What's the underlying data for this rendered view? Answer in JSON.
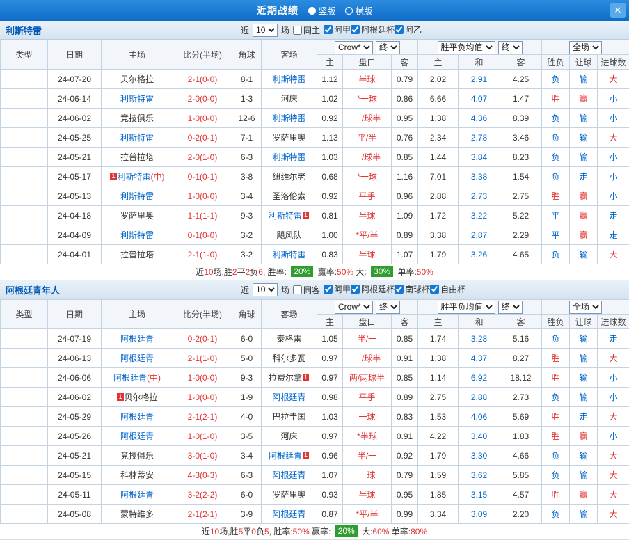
{
  "topbar": {
    "title": "近期战绩",
    "vertical": "竖版",
    "horizontal": "横版",
    "close_glyph": "✕"
  },
  "labels": {
    "near": "近",
    "count": "10",
    "games": "场"
  },
  "badge_char": "1",
  "th": {
    "type": "类型",
    "date": "日期",
    "host": "主场",
    "score": "比分(半场)",
    "corner": "角球",
    "guest": "客场",
    "company": "Crow*",
    "final": "终",
    "avg": "胜平负均值",
    "scope": "全场",
    "home": "主",
    "handicap": "盘口",
    "away": "客",
    "avg_home": "主",
    "avg_draw": "和",
    "avg_away": "客",
    "result": "胜负",
    "let": "让球",
    "goals": "进球数"
  },
  "colors": {
    "topbar_blue": "#1177d4",
    "accent_blue": "#0066cc",
    "score_red": "#e23333",
    "league_jia_blue": "#4190e2",
    "league_cup_purple": "#6673c4",
    "league_nan_gold": "#d09b35",
    "badge_green": "#2f9e2f"
  },
  "sections": [
    {
      "title": "利斯特雷",
      "same_label": "同主",
      "filters": [
        {
          "label": "阿甲",
          "checked": true
        },
        {
          "label": "阿根廷杯",
          "checked": true
        },
        {
          "label": "阿乙",
          "checked": true
        }
      ],
      "rows": [
        {
          "lg": "阿甲",
          "lgc": "jia",
          "d": "24-07-20",
          "h": {
            "n": "贝尔格拉"
          },
          "sc": "2-1(0-0)",
          "cn": "8-1",
          "a": {
            "n": "利斯特雷",
            "sel": 1
          },
          "o1": "1.12",
          "hp": "半球",
          "o2": "0.79",
          "m1": "2.02",
          "m2": "2.91",
          "m3": "4.25",
          "r1": "负",
          "c1": "b",
          "r2": "输",
          "c2": "b",
          "r3": "大",
          "c3": "r"
        },
        {
          "lg": "阿甲",
          "lgc": "jia",
          "d": "24-06-14",
          "h": {
            "n": "利斯特雷",
            "sel": 1
          },
          "sc": "2-0(0-0)",
          "cn": "1-3",
          "a": {
            "n": "河床"
          },
          "o1": "1.02",
          "hp": "*一球",
          "o2": "0.86",
          "m1": "6.66",
          "m2": "4.07",
          "m3": "1.47",
          "r1": "胜",
          "c1": "r",
          "r2": "赢",
          "c2": "r",
          "r3": "小",
          "c3": "b"
        },
        {
          "lg": "阿甲",
          "lgc": "jia",
          "d": "24-06-02",
          "h": {
            "n": "竞技俱乐"
          },
          "sc": "1-0(0-0)",
          "cn": "12-6",
          "a": {
            "n": "利斯特雷",
            "sel": 1
          },
          "o1": "0.92",
          "hp": "一/球半",
          "o2": "0.95",
          "m1": "1.38",
          "m2": "4.36",
          "m3": "8.39",
          "r1": "负",
          "c1": "b",
          "r2": "输",
          "c2": "b",
          "r3": "小",
          "c3": "b"
        },
        {
          "lg": "阿甲",
          "lgc": "jia",
          "d": "24-05-25",
          "h": {
            "n": "利斯特雷",
            "sel": 1
          },
          "sc": "0-2(0-1)",
          "cn": "7-1",
          "a": {
            "n": "罗萨里奥"
          },
          "o1": "1.13",
          "hp": "平/半",
          "o2": "0.76",
          "m1": "2.34",
          "m2": "2.78",
          "m3": "3.46",
          "r1": "负",
          "c1": "b",
          "r2": "输",
          "c2": "b",
          "r3": "大",
          "c3": "r"
        },
        {
          "lg": "阿甲",
          "lgc": "jia",
          "d": "24-05-21",
          "h": {
            "n": "拉普拉塔"
          },
          "sc": "2-0(1-0)",
          "cn": "6-3",
          "a": {
            "n": "利斯特雷",
            "sel": 1
          },
          "o1": "1.03",
          "hp": "一/球半",
          "o2": "0.85",
          "m1": "1.44",
          "m2": "3.84",
          "m3": "8.23",
          "r1": "负",
          "c1": "b",
          "r2": "输",
          "c2": "b",
          "r3": "小",
          "c3": "b"
        },
        {
          "lg": "阿根廷杯",
          "lgc": "cup",
          "d": "24-05-17",
          "h": {
            "n": "利斯特雷",
            "sel": 1,
            "bd": "b",
            "mk": "(中)"
          },
          "sc": "0-1(0-1)",
          "cn": "3-8",
          "a": {
            "n": "纽维尔老"
          },
          "o1": "0.68",
          "hp": "*一球",
          "o2": "1.16",
          "m1": "7.01",
          "m2": "3.38",
          "m3": "1.54",
          "r1": "负",
          "c1": "b",
          "r2": "走",
          "c2": "b",
          "r3": "小",
          "c3": "b"
        },
        {
          "lg": "阿甲",
          "lgc": "jia",
          "d": "24-05-13",
          "h": {
            "n": "利斯特雷",
            "sel": 1
          },
          "sc": "1-0(0-0)",
          "cn": "3-4",
          "a": {
            "n": "圣洛伦索"
          },
          "o1": "0.92",
          "hp": "平手",
          "o2": "0.96",
          "m1": "2.88",
          "m2": "2.73",
          "m3": "2.75",
          "r1": "胜",
          "c1": "r",
          "r2": "赢",
          "c2": "r",
          "r3": "小",
          "c3": "b"
        },
        {
          "lg": "阿甲",
          "lgc": "jia",
          "d": "24-04-18",
          "h": {
            "n": "罗萨里奥"
          },
          "sc": "1-1(1-1)",
          "cn": "9-3",
          "a": {
            "n": "利斯特雷",
            "sel": 1,
            "bd": "a"
          },
          "o1": "0.81",
          "hp": "半球",
          "o2": "1.09",
          "m1": "1.72",
          "m2": "3.22",
          "m3": "5.22",
          "r1": "平",
          "c1": "b",
          "r2": "赢",
          "c2": "r",
          "r3": "走",
          "c3": "b"
        },
        {
          "lg": "阿甲",
          "lgc": "jia",
          "d": "24-04-09",
          "h": {
            "n": "利斯特雷",
            "sel": 1
          },
          "sc": "0-1(0-0)",
          "cn": "3-2",
          "a": {
            "n": "飓风队"
          },
          "o1": "1.00",
          "hp": "*平/半",
          "o2": "0.89",
          "m1": "3.38",
          "m2": "2.87",
          "m3": "2.29",
          "r1": "平",
          "c1": "b",
          "r2": "赢",
          "c2": "r",
          "r3": "走",
          "c3": "b"
        },
        {
          "lg": "阿甲",
          "lgc": "jia",
          "d": "24-04-01",
          "h": {
            "n": "拉普拉塔"
          },
          "sc": "2-1(1-0)",
          "cn": "3-2",
          "a": {
            "n": "利斯特雷",
            "sel": 1
          },
          "o1": "0.83",
          "hp": "半球",
          "o2": "1.07",
          "m1": "1.79",
          "m2": "3.26",
          "m3": "4.65",
          "r1": "负",
          "c1": "b",
          "r2": "输",
          "c2": "b",
          "r3": "大",
          "c3": "r"
        }
      ],
      "footer": [
        {
          "t": "近"
        },
        {
          "t": "10",
          "c": "red"
        },
        {
          "t": "场,胜"
        },
        {
          "t": "2",
          "c": "red"
        },
        {
          "t": "平"
        },
        {
          "t": "2",
          "c": "red"
        },
        {
          "t": "负"
        },
        {
          "t": "6",
          "c": "red"
        },
        {
          "t": ", 胜率: "
        },
        {
          "t": "20%",
          "c": "badge"
        },
        {
          "t": " 赢率:"
        },
        {
          "t": "50%",
          "c": "red"
        },
        {
          "t": " 大: "
        },
        {
          "t": "30%",
          "c": "badge"
        },
        {
          "t": " 单率:"
        },
        {
          "t": "50%",
          "c": "red"
        }
      ]
    },
    {
      "title": "阿根廷青年人",
      "same_label": "同客",
      "filters": [
        {
          "label": "阿甲",
          "checked": true
        },
        {
          "label": "阿根廷杯",
          "checked": true
        },
        {
          "label": "南球杯",
          "checked": true
        },
        {
          "label": "自由杯",
          "checked": true
        }
      ],
      "rows": [
        {
          "lg": "阿甲",
          "lgc": "jia",
          "d": "24-07-19",
          "h": {
            "n": "阿根廷青",
            "sel": 1
          },
          "sc": "0-2(0-1)",
          "cn": "6-0",
          "a": {
            "n": "泰格雷"
          },
          "o1": "1.05",
          "hp": "半/一",
          "o2": "0.85",
          "m1": "1.74",
          "m2": "3.28",
          "m3": "5.16",
          "r1": "负",
          "c1": "b",
          "r2": "输",
          "c2": "b",
          "r3": "走",
          "c3": "b"
        },
        {
          "lg": "阿甲",
          "lgc": "jia",
          "d": "24-06-13",
          "h": {
            "n": "阿根廷青",
            "sel": 1
          },
          "sc": "2-1(1-0)",
          "cn": "5-0",
          "a": {
            "n": "科尔多瓦"
          },
          "o1": "0.97",
          "hp": "一/球半",
          "o2": "0.91",
          "m1": "1.38",
          "m2": "4.37",
          "m3": "8.27",
          "r1": "胜",
          "c1": "r",
          "r2": "输",
          "c2": "b",
          "r3": "大",
          "c3": "r"
        },
        {
          "lg": "阿根廷杯",
          "lgc": "cup",
          "d": "24-06-06",
          "h": {
            "n": "阿根廷青",
            "sel": 1,
            "mk": "(中)"
          },
          "sc": "1-0(0-0)",
          "cn": "9-3",
          "a": {
            "n": "拉费尔拿",
            "bd": "a"
          },
          "o1": "0.97",
          "hp": "两/两球半",
          "o2": "0.85",
          "m1": "1.14",
          "m2": "6.92",
          "m3": "18.12",
          "r1": "胜",
          "c1": "r",
          "r2": "输",
          "c2": "b",
          "r3": "小",
          "c3": "b"
        },
        {
          "lg": "阿甲",
          "lgc": "jia",
          "d": "24-06-02",
          "h": {
            "n": "贝尔格拉",
            "bd": "b"
          },
          "sc": "1-0(0-0)",
          "cn": "1-9",
          "a": {
            "n": "阿根廷青",
            "sel": 1
          },
          "o1": "0.98",
          "hp": "平手",
          "o2": "0.89",
          "m1": "2.75",
          "m2": "2.88",
          "m3": "2.73",
          "r1": "负",
          "c1": "b",
          "r2": "输",
          "c2": "b",
          "r3": "小",
          "c3": "b"
        },
        {
          "lg": "南球杯",
          "lgc": "nan",
          "d": "24-05-29",
          "h": {
            "n": "阿根廷青",
            "sel": 1
          },
          "sc": "2-1(2-1)",
          "cn": "4-0",
          "a": {
            "n": "巴拉圭国"
          },
          "o1": "1.03",
          "hp": "一球",
          "o2": "0.83",
          "m1": "1.53",
          "m2": "4.06",
          "m3": "5.69",
          "r1": "胜",
          "c1": "r",
          "r2": "走",
          "c2": "b",
          "r3": "大",
          "c3": "r"
        },
        {
          "lg": "阿甲",
          "lgc": "jia",
          "d": "24-05-26",
          "h": {
            "n": "阿根廷青",
            "sel": 1
          },
          "sc": "1-0(1-0)",
          "cn": "3-5",
          "a": {
            "n": "河床"
          },
          "o1": "0.97",
          "hp": "*半球",
          "o2": "0.91",
          "m1": "4.22",
          "m2": "3.40",
          "m3": "1.83",
          "r1": "胜",
          "c1": "r",
          "r2": "赢",
          "c2": "r",
          "r3": "小",
          "c3": "b"
        },
        {
          "lg": "阿甲",
          "lgc": "jia",
          "d": "24-05-21",
          "h": {
            "n": "竞技俱乐"
          },
          "sc": "3-0(1-0)",
          "cn": "3-4",
          "a": {
            "n": "阿根廷青",
            "sel": 1,
            "bd": "a"
          },
          "o1": "0.96",
          "hp": "半/一",
          "o2": "0.92",
          "m1": "1.79",
          "m2": "3.30",
          "m3": "4.66",
          "r1": "负",
          "c1": "b",
          "r2": "输",
          "c2": "b",
          "r3": "大",
          "c3": "r"
        },
        {
          "lg": "南球杯",
          "lgc": "nan",
          "d": "24-05-15",
          "h": {
            "n": "科林蒂安"
          },
          "sc": "4-3(0-3)",
          "cn": "6-3",
          "a": {
            "n": "阿根廷青",
            "sel": 1
          },
          "o1": "1.07",
          "hp": "一球",
          "o2": "0.79",
          "m1": "1.59",
          "m2": "3.62",
          "m3": "5.85",
          "r1": "负",
          "c1": "b",
          "r2": "输",
          "c2": "b",
          "r3": "大",
          "c3": "r"
        },
        {
          "lg": "阿甲",
          "lgc": "jia",
          "d": "24-05-11",
          "h": {
            "n": "阿根廷青",
            "sel": 1
          },
          "sc": "3-2(2-2)",
          "cn": "6-0",
          "a": {
            "n": "罗萨里奥"
          },
          "o1": "0.93",
          "hp": "半球",
          "o2": "0.95",
          "m1": "1.85",
          "m2": "3.15",
          "m3": "4.57",
          "r1": "胜",
          "c1": "r",
          "r2": "赢",
          "c2": "r",
          "r3": "大",
          "c3": "r"
        },
        {
          "lg": "南球杯",
          "lgc": "nan",
          "d": "24-05-08",
          "h": {
            "n": "蒙特维多"
          },
          "sc": "2-1(2-1)",
          "cn": "3-9",
          "a": {
            "n": "阿根廷青",
            "sel": 1
          },
          "o1": "0.87",
          "hp": "*平/半",
          "o2": "0.99",
          "m1": "3.34",
          "m2": "3.09",
          "m3": "2.20",
          "r1": "负",
          "c1": "b",
          "r2": "输",
          "c2": "b",
          "r3": "大",
          "c3": "r"
        }
      ],
      "footer": [
        {
          "t": "近"
        },
        {
          "t": "10",
          "c": "red"
        },
        {
          "t": "场,胜"
        },
        {
          "t": "5",
          "c": "red"
        },
        {
          "t": "平"
        },
        {
          "t": "0",
          "c": "red"
        },
        {
          "t": "负"
        },
        {
          "t": "5",
          "c": "red"
        },
        {
          "t": ", 胜率:"
        },
        {
          "t": "50%",
          "c": "red"
        },
        {
          "t": " 赢率: "
        },
        {
          "t": "20%",
          "c": "badge"
        },
        {
          "t": " 大:"
        },
        {
          "t": "60%",
          "c": "red"
        },
        {
          "t": " 单率:"
        },
        {
          "t": "80%",
          "c": "red"
        }
      ]
    }
  ]
}
